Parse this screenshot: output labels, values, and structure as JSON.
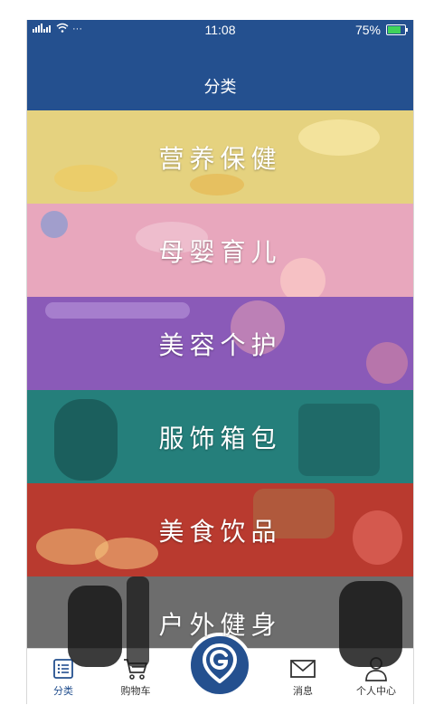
{
  "status_bar": {
    "signal_left": "4G 2G",
    "dots": "···",
    "time": "11:08",
    "battery_percent": "75%",
    "battery_level": 0.75,
    "battery_color": "#3fd35a"
  },
  "header": {
    "title": "分类",
    "color": "#24508f"
  },
  "categories": [
    {
      "label": "营养保健",
      "color": "#e5d27f"
    },
    {
      "label": "母婴育儿",
      "color": "#e8a7bd"
    },
    {
      "label": "美容个护",
      "color": "#8a5ab8"
    },
    {
      "label": "服饰箱包",
      "color": "#257f7b"
    },
    {
      "label": "美食饮品",
      "color": "#b93a2f"
    },
    {
      "label": "户外健身",
      "color": "#6d6d6d"
    }
  ],
  "tabbar": {
    "items": [
      {
        "label": "分类",
        "icon": "list-icon",
        "active": true
      },
      {
        "label": "购物车",
        "icon": "cart-icon"
      },
      {
        "label": "",
        "icon": "logo-g-icon"
      },
      {
        "label": "消息",
        "icon": "mail-icon"
      },
      {
        "label": "个人中心",
        "icon": "person-icon"
      }
    ]
  }
}
